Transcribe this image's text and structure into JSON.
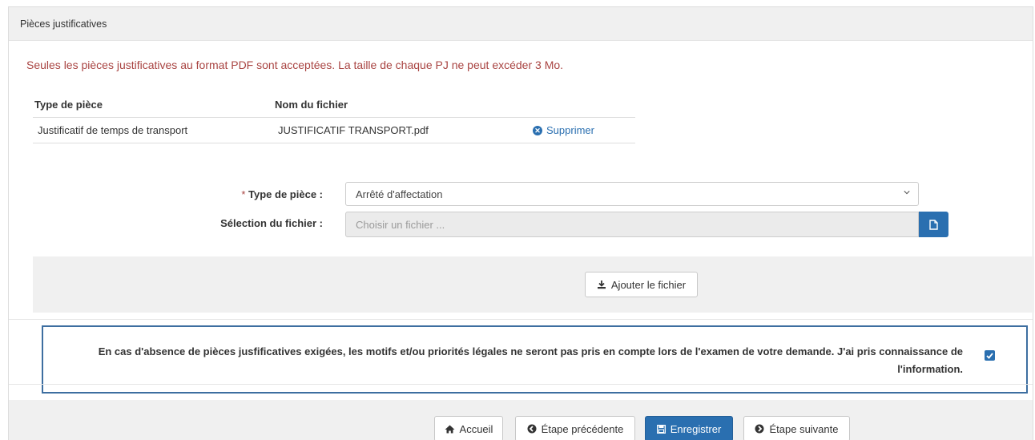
{
  "panel": {
    "title": "Pièces justificatives"
  },
  "notice": "Seules les pièces justificatives au format PDF sont acceptées. La taille de chaque PJ ne peut excéder 3 Mo.",
  "table": {
    "headers": [
      "Type de pièce",
      "Nom du fichier",
      ""
    ],
    "rows": [
      {
        "type": "Justificatif de temps de transport",
        "file": "JUSTIFICATIF TRANSPORT.pdf",
        "action": "Supprimer"
      }
    ]
  },
  "form": {
    "required_mark": "*",
    "type_label": "Type de pièce :",
    "type_value": "Arrêté d'affectation",
    "file_label": "Sélection du fichier :",
    "file_placeholder": "Choisir un fichier ...",
    "add_button": "Ajouter le fichier"
  },
  "acknowledgement": {
    "text": "En cas d'absence de pièces jusfificatives exigées, les motifs et/ou priorités légales ne seront pas pris en compte lors de l'examen de votre demande. J'ai pris connaissance de l'information.",
    "checked": true
  },
  "footer": {
    "home": "Accueil",
    "previous": "Étape précédente",
    "save": "Enregistrer",
    "next": "Étape suivante"
  },
  "colors": {
    "primary": "#2a6fb0",
    "notice": "#a94442",
    "box_border": "#3d6ea0"
  }
}
